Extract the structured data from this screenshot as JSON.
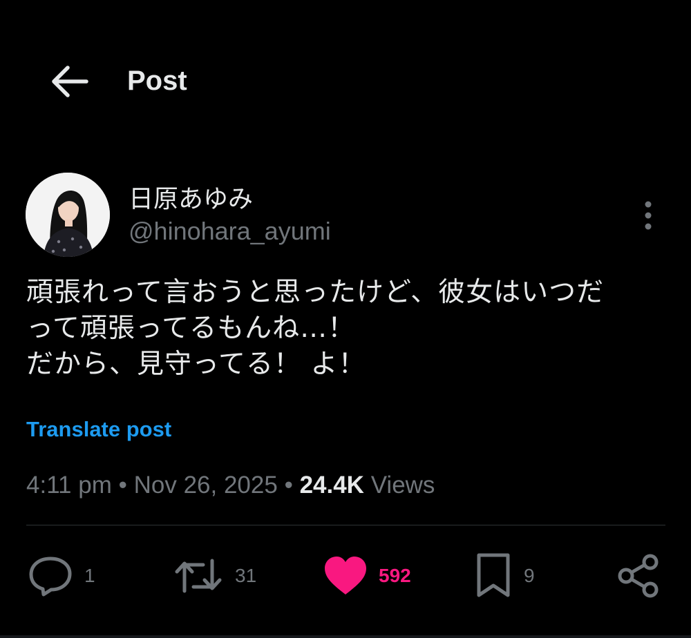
{
  "header": {
    "title": "Post",
    "back_icon": "arrow-left-icon"
  },
  "author": {
    "display_name": "日原あゆみ",
    "handle": "@hinohara_ayumi"
  },
  "post": {
    "lines": [
      "頑張れって言おうと思ったけど、彼女はいつだ",
      "って頑張ってるもんね…！",
      "だから、見守ってる！ よ！"
    ],
    "translate_label": "Translate post"
  },
  "meta": {
    "time": "4:11 pm",
    "separator": "•",
    "date": "Nov 26, 2025",
    "views_count": "24.4K",
    "views_label": "Views"
  },
  "actions": {
    "replies": "1",
    "reposts": "31",
    "likes": "592",
    "bookmarks": "9"
  },
  "colors": {
    "background": "#000000",
    "text": "#e7e9ea",
    "secondary": "#71767b",
    "link": "#1d9bf0",
    "like": "#f91880",
    "divider": "#2f3336"
  }
}
